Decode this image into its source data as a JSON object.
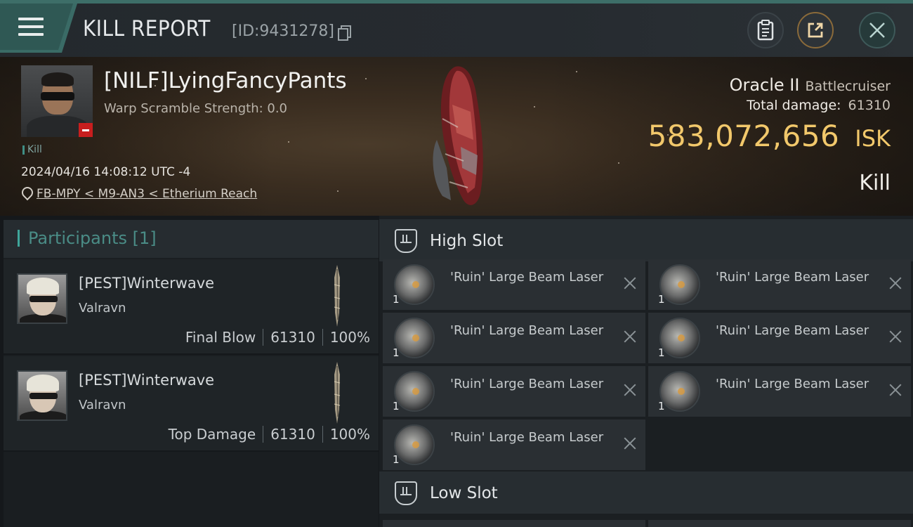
{
  "header": {
    "title": "KILL REPORT",
    "report_id": "[ID:9431278]",
    "icons": {
      "menu": "menu-icon",
      "copy": "copy-icon",
      "clipboard": "clipboard-icon",
      "share": "share-icon",
      "close": "close-icon"
    }
  },
  "victim": {
    "name": "[NILF]LyingFancyPants",
    "warp_scramble": "Warp Scramble Strength: 0.0",
    "tag": "Kill",
    "timestamp": "2024/04/16 14:08:12 UTC -4",
    "location": "FB-MPY < M9-AN3 < Etherium Reach",
    "ship_name": "Oracle II",
    "ship_class": "Battlecruiser",
    "total_damage_label": "Total damage:",
    "total_damage": "61310",
    "isk_value": "583,072,656",
    "isk_unit": "ISK",
    "result": "Kill"
  },
  "participants": {
    "title": "Participants [1]",
    "rows": [
      {
        "name": "[PEST]Winterwave",
        "ship": "Valravn",
        "role": "Final Blow",
        "damage": "61310",
        "percent": "100%"
      },
      {
        "name": "[PEST]Winterwave",
        "ship": "Valravn",
        "role": "Top Damage",
        "damage": "61310",
        "percent": "100%"
      }
    ]
  },
  "fitting": {
    "high_slot_title": "High Slot",
    "low_slot_title": "Low Slot",
    "high_modules": [
      {
        "name": "'Ruin' Large Beam Laser",
        "qty": "1"
      },
      {
        "name": "'Ruin' Large Beam Laser",
        "qty": "1"
      },
      {
        "name": "'Ruin' Large Beam Laser",
        "qty": "1"
      },
      {
        "name": "'Ruin' Large Beam Laser",
        "qty": "1"
      },
      {
        "name": "'Ruin' Large Beam Laser",
        "qty": "1"
      },
      {
        "name": "'Ruin' Large Beam Laser",
        "qty": "1"
      },
      {
        "name": "'Ruin' Large Beam Laser",
        "qty": "1"
      }
    ]
  },
  "colors": {
    "accent_teal": "#3fa69b",
    "isk_gold": "#f2c86b",
    "badge_red": "#c81e1e"
  }
}
